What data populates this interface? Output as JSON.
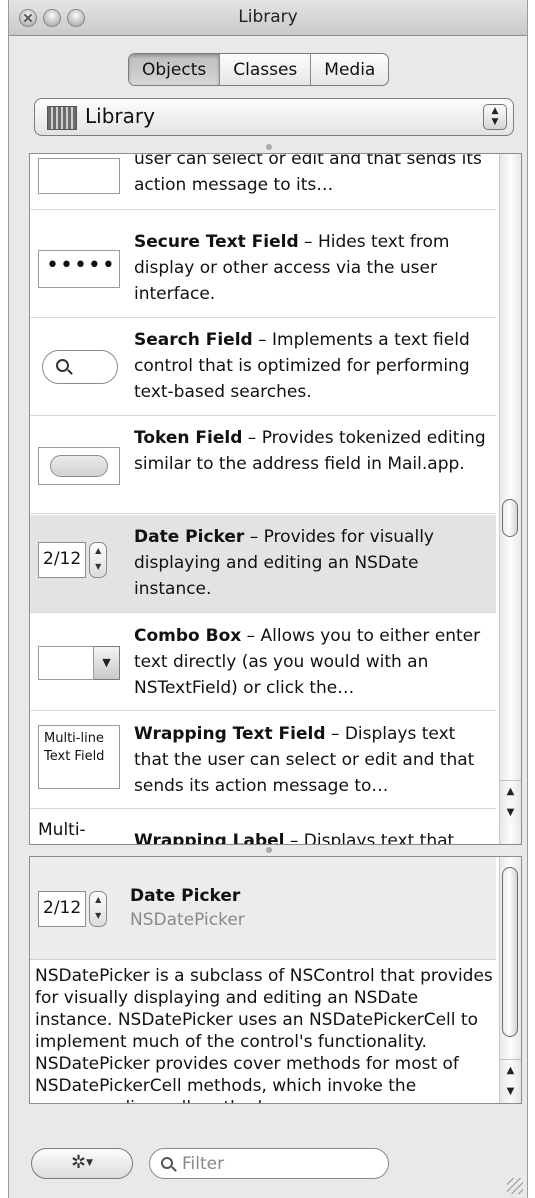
{
  "window": {
    "title": "Library"
  },
  "segments": [
    {
      "label": "Objects",
      "active": true
    },
    {
      "label": "Classes",
      "active": false
    },
    {
      "label": "Media",
      "active": false
    }
  ],
  "popup": {
    "label": "Library",
    "icon": "library-book-icon"
  },
  "list": {
    "items": [
      {
        "name": "",
        "description": "user can select or edit and that sends its action message to its…",
        "thumb": "text-field"
      },
      {
        "name": "Secure Text Field",
        "description": " – Hides text from display or other access via the user interface.",
        "thumb": "secure-text-field",
        "thumb_text": "•••••"
      },
      {
        "name": "Search Field",
        "description": " – Implements a text field control that is optimized for performing text-based searches.",
        "thumb": "search-field"
      },
      {
        "name": "Token Field",
        "description": " – Provides tokenized editing similar to the address field in Mail.app.",
        "thumb": "token-field"
      },
      {
        "name": "Date Picker",
        "description": " – Provides for visually displaying and editing an NSDate instance.",
        "thumb": "date-picker",
        "thumb_text": "2/12",
        "selected": true
      },
      {
        "name": "Combo Box",
        "description": " – Allows you to either enter text directly (as you would with an NSTextField) or click the…",
        "thumb": "combo-box"
      },
      {
        "name": "Wrapping Text Field",
        "description": " – Displays text that the user can select or edit and that sends its action message to…",
        "thumb": "wrapping-text-field",
        "thumb_text": "Multi-line Text Field"
      },
      {
        "name": "Wrapping Label",
        "description": " – Displays text that",
        "thumb": "wrapping-label",
        "thumb_text": "Multi-"
      }
    ]
  },
  "detail": {
    "thumb_text": "2/12",
    "name": "Date Picker",
    "class_name": "NSDatePicker",
    "text": "NSDatePicker is a subclass of NSControl that provides for visually displaying and editing an NSDate instance. NSDatePicker uses an NSDatePickerCell to implement much of the control's functionality. NSDatePicker provides cover methods for most of NSDatePickerCell methods, which invoke the corresponding cell method."
  },
  "bottom": {
    "action_icon": "gear-icon",
    "filter_placeholder": "Filter",
    "filter_value": ""
  }
}
